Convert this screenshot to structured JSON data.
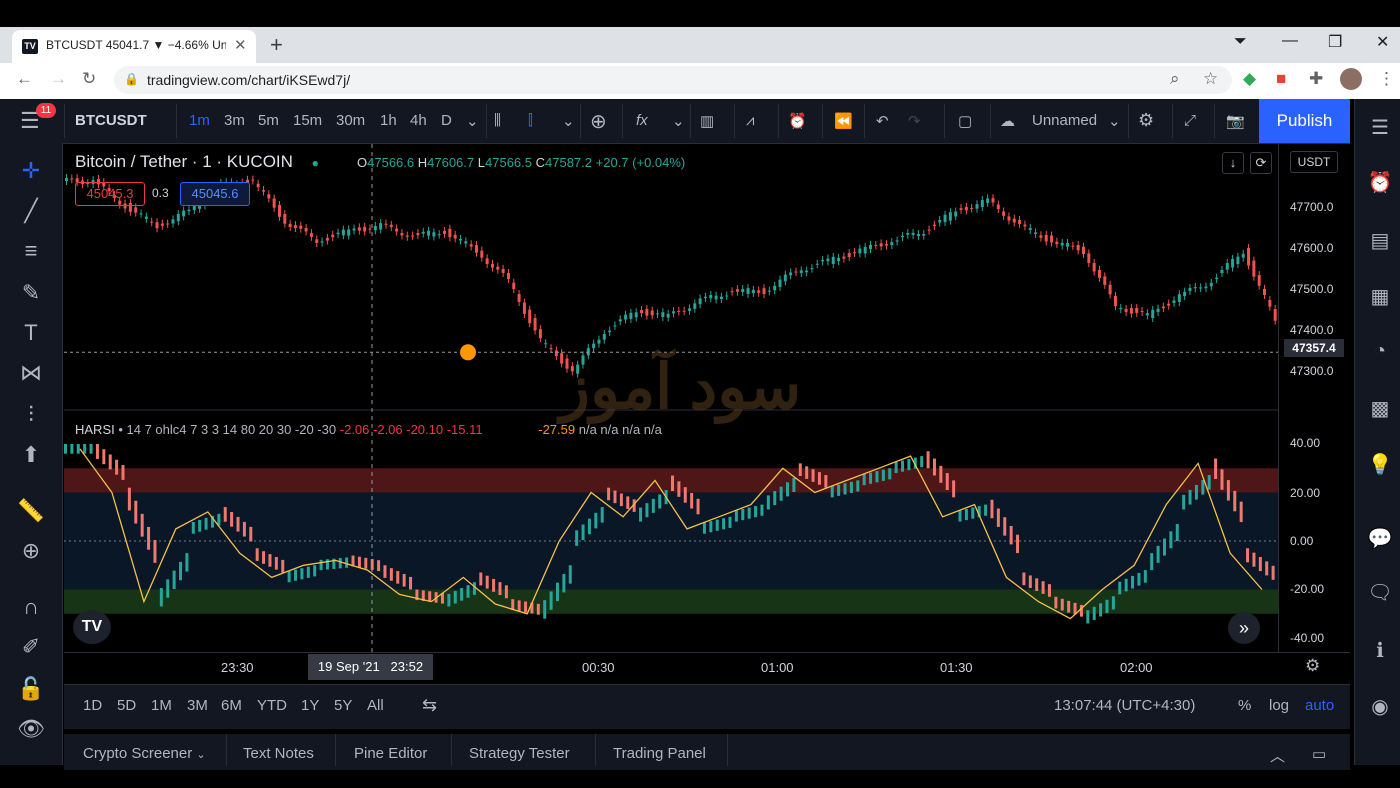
{
  "browser": {
    "tab_title": "BTCUSDT 45041.7 ▼ −4.66% Unnamed",
    "url": "tradingview.com/chart/iKSEwd7j/"
  },
  "toolbar": {
    "symbol": "BTCUSDT",
    "intervals": [
      "1m",
      "3m",
      "5m",
      "15m",
      "30m",
      "1h",
      "4h",
      "D"
    ],
    "active_interval": "1m",
    "layout_name": "Unnamed",
    "publish_label": "Publish"
  },
  "left_badge": "11",
  "chart": {
    "title": "Bitcoin / Tether · 1 · KUCOIN",
    "ohlc": {
      "o_label": "O",
      "o": "47566.6",
      "h_label": "H",
      "h": "47606.7",
      "l_label": "L",
      "l": "47566.5",
      "c_label": "C",
      "c": "47587.2",
      "change": "+20.7 (+0.04%)"
    },
    "bid": "45045.3",
    "spread": "0.3",
    "ask": "45045.6",
    "currency": "USDT",
    "current_price": "47357.4",
    "price_ticks": [
      "47700.0",
      "47600.0",
      "47500.0",
      "47400.0",
      "47300.0"
    ],
    "watermark": "سود آموز"
  },
  "indicator": {
    "name": "HARSI",
    "params": "• 14 7 ohlc4 7 3 3 14 80 20 30 -20 -30",
    "values_red": "-2.06  -2.06  -20.10  -15.11",
    "value_orange": "-27.59",
    "values_na": "n/a  n/a  n/a  n/a",
    "ticks": [
      "40.00",
      "20.00",
      "0.00",
      "-20.00",
      "-40.00"
    ]
  },
  "time_axis": {
    "labels": [
      "23:30",
      "00:30",
      "01:00",
      "01:30",
      "02:00"
    ],
    "crosshair_date": "19 Sep '21",
    "crosshair_time": "23:52"
  },
  "range_bar": {
    "ranges": [
      "1D",
      "5D",
      "1M",
      "3M",
      "6M",
      "YTD",
      "1Y",
      "5Y",
      "All"
    ],
    "clock": "13:07:44 (UTC+4:30)",
    "percent": "%",
    "log": "log",
    "auto": "auto"
  },
  "bottom_tabs": [
    "Crypto Screener",
    "Text Notes",
    "Pine Editor",
    "Strategy Tester",
    "Trading Panel"
  ],
  "chart_data": {
    "type": "line",
    "price_series": {
      "name": "BTCUSDT",
      "x": [
        "23:20",
        "23:25",
        "23:30",
        "23:35",
        "23:40",
        "23:45",
        "23:50",
        "23:55",
        "00:00",
        "00:05",
        "00:10",
        "00:15",
        "00:20",
        "00:25",
        "00:30",
        "00:35",
        "00:40",
        "00:45",
        "00:50",
        "00:55",
        "01:00",
        "01:05",
        "01:10",
        "01:15",
        "01:20",
        "01:25",
        "01:30",
        "01:35",
        "01:40",
        "01:45",
        "01:50",
        "01:55",
        "02:00",
        "02:05",
        "02:10",
        "02:15",
        "02:20",
        "02:25"
      ],
      "values": [
        47700,
        47650,
        47610,
        47640,
        47690,
        47700,
        47620,
        47580,
        47600,
        47610,
        47590,
        47600,
        47560,
        47500,
        47380,
        47320,
        47400,
        47440,
        47430,
        47460,
        47480,
        47480,
        47520,
        47540,
        47560,
        47580,
        47600,
        47640,
        47660,
        47610,
        47580,
        47560,
        47450,
        47430,
        47470,
        47500,
        47560,
        47420
      ],
      "ylim": [
        47250,
        47750
      ]
    },
    "oscillator_series": {
      "name": "HARSI",
      "values": [
        38,
        20,
        -25,
        5,
        12,
        -5,
        -15,
        -10,
        -8,
        -12,
        -22,
        -25,
        -15,
        -26,
        -30,
        0,
        20,
        10,
        25,
        5,
        10,
        15,
        30,
        20,
        25,
        30,
        35,
        10,
        15,
        -15,
        -25,
        -32,
        -20,
        -10,
        15,
        32,
        -5,
        -20
      ],
      "ylim": [
        -40,
        40
      ],
      "levels": [
        30,
        20,
        -20,
        -30
      ]
    }
  }
}
